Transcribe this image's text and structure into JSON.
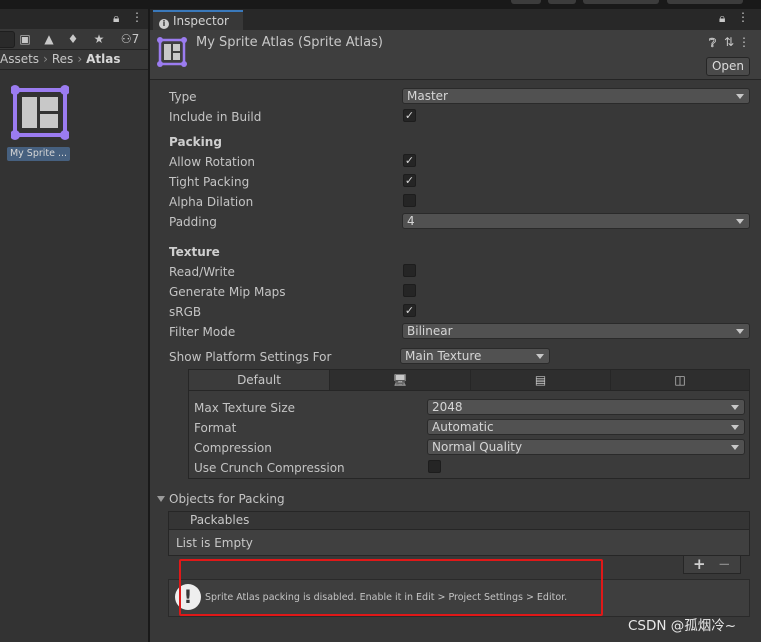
{
  "project": {
    "filter_count": "7",
    "breadcrumb": [
      "Assets",
      "Res",
      "Atlas"
    ],
    "asset_label": "My Sprite ..."
  },
  "inspector": {
    "tab_label": "Inspector",
    "title": "My Sprite Atlas (Sprite Atlas)",
    "open_label": "Open"
  },
  "fields": {
    "type_label": "Type",
    "type_value": "Master",
    "include_label": "Include in Build",
    "include_checked": true,
    "packing_header": "Packing",
    "allow_rotation_label": "Allow Rotation",
    "allow_rotation_checked": true,
    "tight_packing_label": "Tight Packing",
    "tight_packing_checked": true,
    "alpha_dilation_label": "Alpha Dilation",
    "alpha_dilation_checked": false,
    "padding_label": "Padding",
    "padding_value": "4",
    "texture_header": "Texture",
    "read_write_label": "Read/Write",
    "read_write_checked": false,
    "mipmaps_label": "Generate Mip Maps",
    "mipmaps_checked": false,
    "srgb_label": "sRGB",
    "srgb_checked": true,
    "filter_label": "Filter Mode",
    "filter_value": "Bilinear",
    "platform_label": "Show Platform Settings For",
    "platform_value": "Main Texture"
  },
  "platform": {
    "tab_default": "Default",
    "tab_icons": [
      "monitor-icon",
      "server-icon",
      "webgl-icon"
    ],
    "max_size_label": "Max Texture Size",
    "max_size_value": "2048",
    "format_label": "Format",
    "format_value": "Automatic",
    "compression_label": "Compression",
    "compression_value": "Normal Quality",
    "crunch_label": "Use Crunch Compression",
    "crunch_checked": false
  },
  "objects": {
    "header": "Objects for Packing",
    "packables_label": "Packables",
    "empty_text": "List is Empty",
    "plus": "+",
    "minus": "−"
  },
  "help": {
    "icon": "!",
    "text": "Sprite Atlas packing is disabled. Enable it in Edit > Project Settings > Editor."
  },
  "watermark": "CSDN @孤烟冷~",
  "colors": {
    "accent": "#3a79bb",
    "highlight_rect": "#e01818",
    "asset_icon": "#9b7cf0"
  }
}
